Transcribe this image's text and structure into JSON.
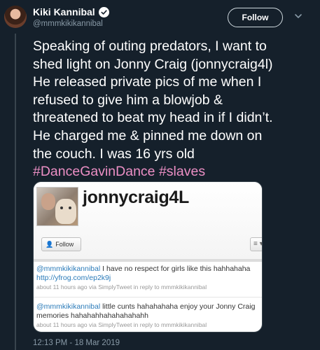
{
  "author": {
    "name": "Kiki Kannibal",
    "handle": "@mmmkikikannibal",
    "verified": true
  },
  "follow_label": "Follow",
  "tweet": {
    "lines": [
      "Speaking of outing predators, I want to",
      "shed light on Jonny Craig (jonnycraig4l)",
      "He released private pics of me when I",
      "refused to give him a blowjob &",
      "threatened to beat my head in if I didn’t.",
      "He charged me & pinned me down on",
      "the couch. I was 16 yrs old"
    ],
    "hashtags": [
      "#DanceGavinDance",
      "#slaves"
    ]
  },
  "media": {
    "screen_name": "jonnycraig4L",
    "follow_label": "Follow",
    "list_icon": "≡ ▾",
    "tweets": [
      {
        "user": "@mmmkikikannibal",
        "text": " I have no respect for girls like this hahhahaha ",
        "link": "http://yfrog.com/ep2k9j",
        "meta_time": "about 11 hours ago via SimplyTweet",
        "meta_reply": " in reply to mmmkikikannibal"
      },
      {
        "user": "@mmmkikikannibal",
        "text": " little cunts hahahahaha enjoy your Jonny Craig memories hahahahhahahahahahh",
        "link": "",
        "meta_time": "about 11 hours ago via SimplyTweet",
        "meta_reply": " in reply to mmmkikikannibal"
      }
    ]
  },
  "timestamp": "12:13 PM - 18 Mar 2019",
  "colors": {
    "background": "#15202b",
    "hashtag": "#ec8fc5",
    "secondary_text": "#8899a6",
    "link": "#2b7bb9"
  },
  "icons": {
    "verified": "verified-badge-icon",
    "caret": "chevron-down-icon",
    "follow_person": "person-plus-icon"
  }
}
